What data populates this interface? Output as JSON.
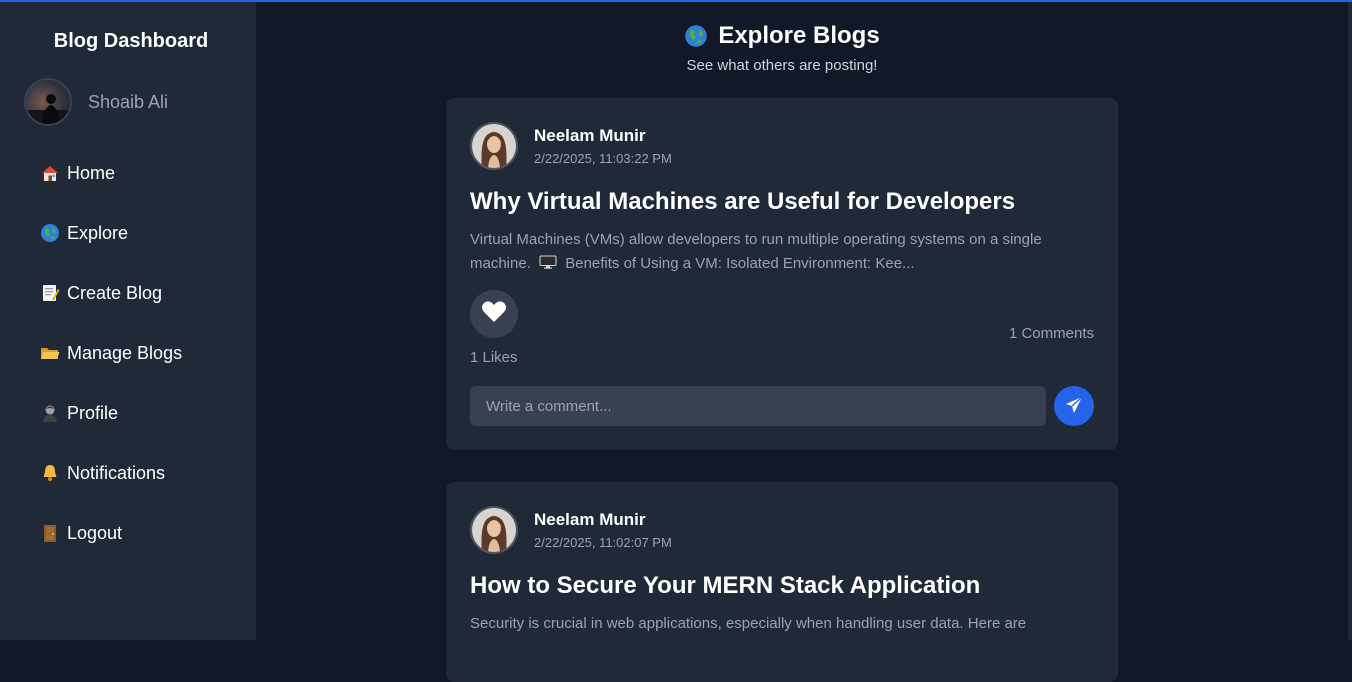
{
  "sidebar": {
    "brand": "Blog Dashboard",
    "user_name": "Shoaib Ali",
    "items": [
      {
        "icon": "house-icon",
        "label": "Home"
      },
      {
        "icon": "globe-icon",
        "label": "Explore"
      },
      {
        "icon": "memo-icon",
        "label": "Create Blog"
      },
      {
        "icon": "folder-icon",
        "label": "Manage Blogs"
      },
      {
        "icon": "person-icon",
        "label": "Profile"
      },
      {
        "icon": "bell-icon",
        "label": "Notifications"
      },
      {
        "icon": "door-icon",
        "label": "Logout"
      }
    ]
  },
  "header": {
    "icon": "globe-icon",
    "title": "Explore Blogs",
    "subtitle": "See what others are posting!"
  },
  "posts": [
    {
      "author": "Neelam Munir",
      "date": "2/22/2025, 11:03:22 PM",
      "title": "Why Virtual Machines are Useful for Developers",
      "excerpt_line1": "Virtual Machines (VMs) allow developers to run multiple operating systems on a single",
      "excerpt_line2_start": "machine.",
      "excerpt_line2_end": "Benefits of Using a VM: Isolated Environment: Kee...",
      "likes": "1 Likes",
      "comments": "1 Comments",
      "comment_placeholder": "Write a comment..."
    },
    {
      "author": "Neelam Munir",
      "date": "2/22/2025, 11:02:07 PM",
      "title": "How to Secure Your MERN Stack Application",
      "excerpt_line1": "Security is crucial in web applications, especially when handling user data. Here are"
    }
  ],
  "colors": {
    "background": "#111827",
    "sidebar": "#1f2937",
    "card": "#1f2937",
    "accent": "#2563eb",
    "muted_text": "#9ca3af"
  }
}
